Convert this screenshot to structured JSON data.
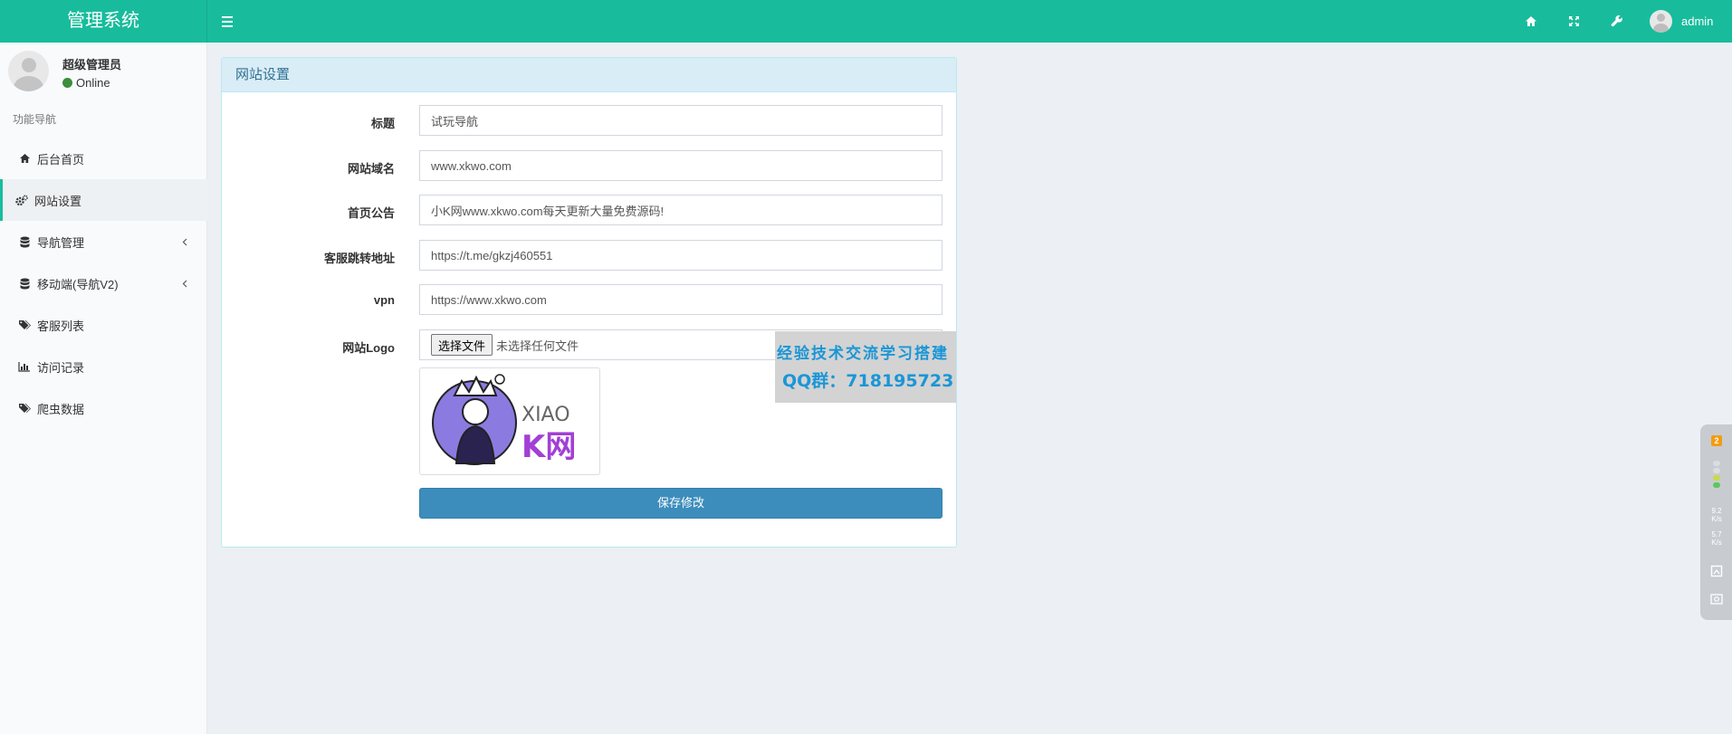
{
  "header": {
    "logo": "管理系统",
    "username": "admin",
    "icons": [
      "menu-toggle-icon",
      "home-icon",
      "fullscreen-icon",
      "wrench-icon"
    ]
  },
  "sidebar": {
    "user_name": "超级管理员",
    "user_status": "Online",
    "nav_header": "功能导航",
    "items": [
      {
        "label": "后台首页",
        "icon": "home-icon"
      },
      {
        "label": "网站设置",
        "icon": "cogs-icon",
        "active": true
      },
      {
        "label": "导航管理",
        "icon": "database-icon",
        "has_children": true
      },
      {
        "label": "移动端(导航V2)",
        "icon": "database-icon",
        "has_children": true
      },
      {
        "label": "客服列表",
        "icon": "tags-icon"
      },
      {
        "label": "访问记录",
        "icon": "bar-chart-icon"
      },
      {
        "label": "爬虫数据",
        "icon": "tags-icon"
      }
    ]
  },
  "panel": {
    "title": "网站设置",
    "fields": [
      {
        "label": "标题",
        "value": "试玩导航"
      },
      {
        "label": "网站域名",
        "value": "www.xkwo.com"
      },
      {
        "label": "首页公告",
        "value": "小K网www.xkwo.com每天更新大量免费源码!"
      },
      {
        "label": "客服跳转地址",
        "value": "https://t.me/gkzj460551"
      },
      {
        "label": "vpn",
        "value": "https://www.xkwo.com"
      }
    ],
    "logo_label": "网站Logo",
    "file_button": "选择文件",
    "file_status": "未选择任何文件",
    "logo_text_top": "XIAO",
    "logo_text_bottom": "K网",
    "save_button": "保存修改"
  },
  "watermark": {
    "line1": "经验技术交流学习搭建",
    "line2": "QQ群：718195723"
  },
  "float_widget": {
    "badge": "2",
    "up_speed": "9.2",
    "up_unit": "K/s",
    "down_speed": "5.7",
    "down_unit": "K/s"
  },
  "colors": {
    "brand": "#18bc9c",
    "primary_button": "#3c8dbc",
    "panel_heading_bg": "#d9edf7",
    "panel_heading_text": "#31708f",
    "watermark_text": "#1a96d6"
  }
}
